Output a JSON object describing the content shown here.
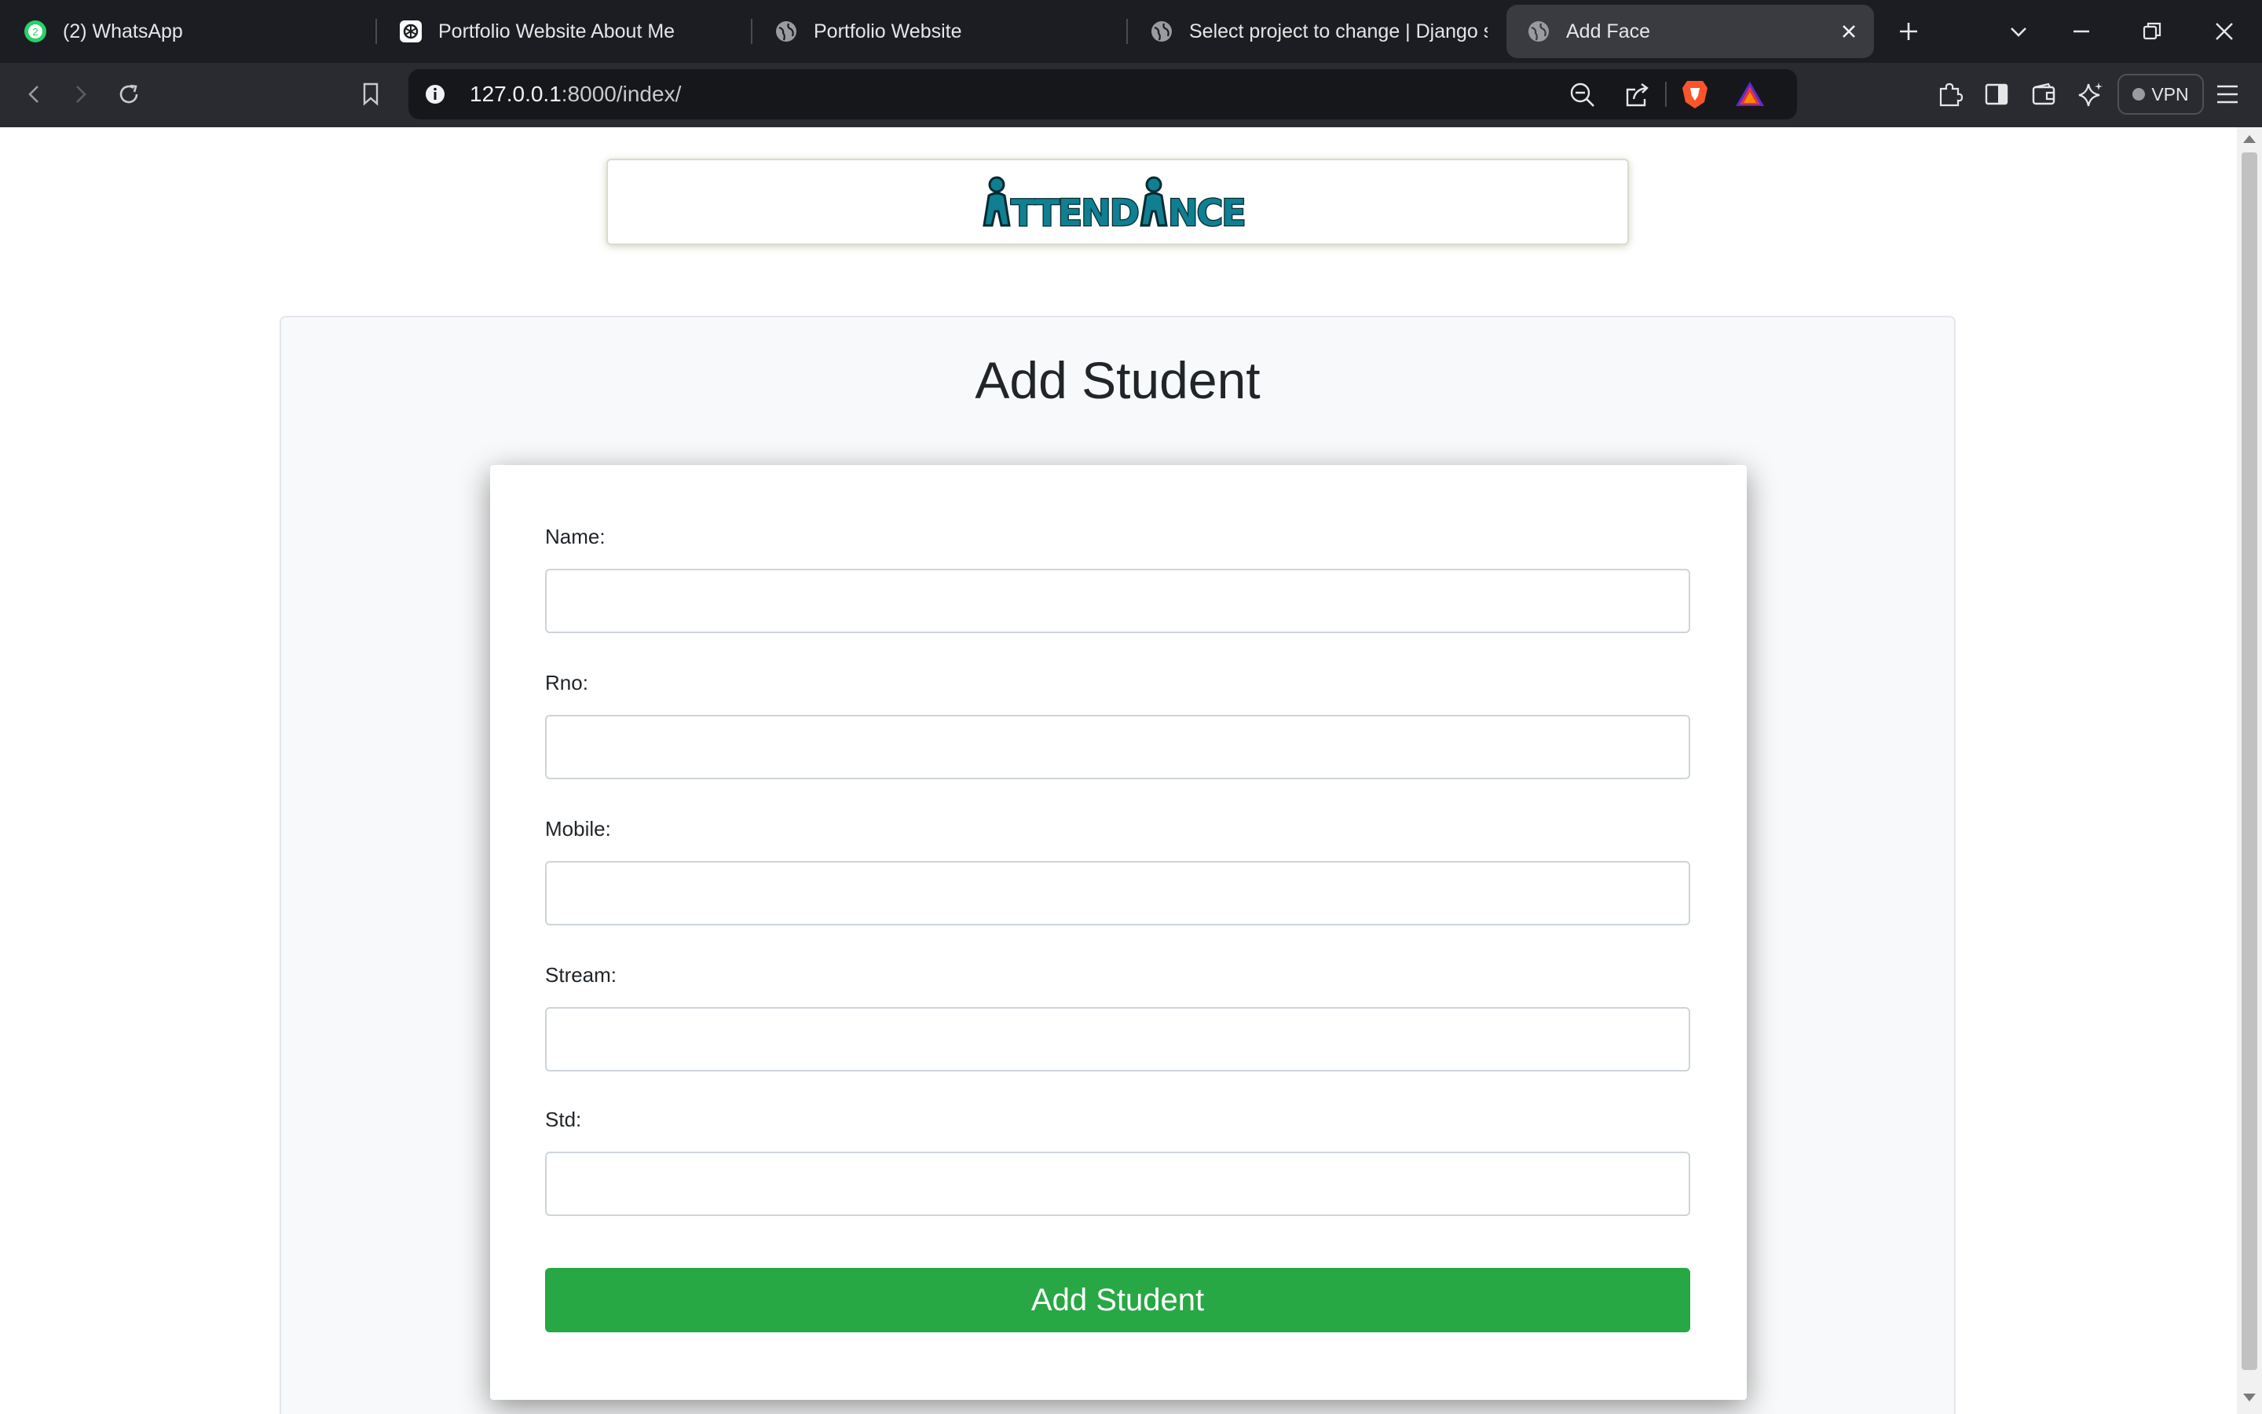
{
  "browser": {
    "tabs": [
      {
        "label": "(2) WhatsApp",
        "icon": "whatsapp-icon",
        "badge": "2"
      },
      {
        "label": "Portfolio Website About Me",
        "icon": "openai-icon"
      },
      {
        "label": "Portfolio Website",
        "icon": "globe-icon"
      },
      {
        "label": "Select project to change | Django sit",
        "icon": "globe-icon"
      },
      {
        "label": "Add Face",
        "icon": "globe-icon",
        "active": true
      }
    ],
    "url_host": "127.0.0.1",
    "url_rest": ":8000/index/",
    "vpn_label": "VPN",
    "brave_color": "#fb542b"
  },
  "page": {
    "logo_text": "ATTENDANCE",
    "title": "Add Student",
    "form": {
      "fields": [
        {
          "label": "Name:",
          "value": ""
        },
        {
          "label": "Rno:",
          "value": ""
        },
        {
          "label": "Mobile:",
          "value": ""
        },
        {
          "label": "Stream:",
          "value": ""
        },
        {
          "label": "Std:",
          "value": ""
        }
      ],
      "submit_label": "Add Student",
      "submit_color": "#28a745"
    }
  }
}
